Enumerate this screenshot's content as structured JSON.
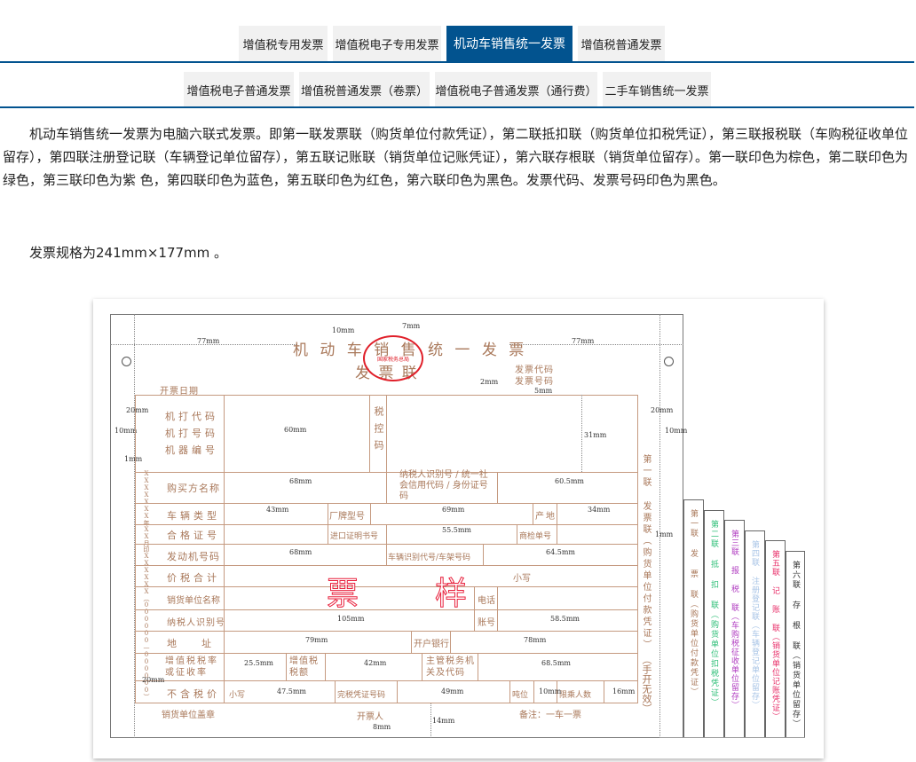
{
  "tabs_row1": [
    "增值税专用发票",
    "增值税电子专用发票",
    "机动车销售统一发票",
    "增值税普通发票"
  ],
  "tabs_row2": [
    "增值税电子普通发票",
    "增值税普通发票（卷票）",
    "增值税电子普通发票（通行费）",
    "二手车销售统一发票"
  ],
  "active_tab": "机动车销售统一发票",
  "description": "机动车销售统一发票为电脑六联式发票。即第一联发票联（购货单位付款凭证），第二联抵扣联（购货单位扣税凭证），第三联报税联（车购税征收单位留存），第四联注册登记联（车辆登记单位留存），第五联记账联（销货单位记账凭证），第六联存根联（销货单位留存）。第一联印色为棕色，第二联印色为绿色，第三联印色为紫 色，第四联印色为蓝色，第五联印色为红色，第六联印色为黑色。发票代码、发票号码印色为黑色。",
  "spec": "发票规格为241mm×177mm 。",
  "invoice": {
    "title": "机 动 车 销 售 统 一 发 票",
    "subtitle": "发 票 联",
    "seal": "国家税务总局",
    "date_label": "开票日期",
    "code_label": "发票代码",
    "number_label": "发票号码",
    "watermark": [
      "票",
      "样"
    ],
    "labels": {
      "machine_code": "机打代码",
      "machine_number": "机打号码",
      "machine_id": "机器编号",
      "tax_code": "税控码",
      "buyer": "购买方名称",
      "buyer_id": "纳税人识别号 / 统一社会信用代码 / 身份证号码",
      "vehicle_type": "车辆类型",
      "brand": "厂牌型号",
      "origin": "产地",
      "cert": "合格证号",
      "import_cert": "进口证明书号",
      "inspection": "商检单号",
      "engine": "发动机号码",
      "vin": "车辆识别代号/车架号码",
      "total": "价税合计",
      "lowercase": "小写",
      "seller": "销货单位名称",
      "phone": "电话",
      "seller_id": "纳税人识别号",
      "account": "账号",
      "address": "地　　址",
      "bank": "开户银行",
      "vat_rate": "增值税税率或征收率",
      "vat_amount": "增值税税额",
      "tax_office": "主管税务机关及代码",
      "net_price": "不含税价",
      "tax_cert": "完税凭证号码",
      "tonnage": "吨位",
      "seats": "限乘人数",
      "seal_label": "销货单位盖章",
      "issuer": "开票人",
      "remark": "备注：一车一票",
      "side_note": "第一联 发票联（购货单位付款凭证）",
      "void_note": "（手开无效）",
      "left_edge": "XXXXXXX年XX月印XXXXXX（000000—000000）"
    },
    "dims": {
      "top_left": "77mm",
      "top_right": "77mm",
      "t10": "10mm",
      "t7": "7mm",
      "t2": "2mm",
      "t5": "5mm",
      "l20": "20mm",
      "l10": "10mm",
      "l1": "1mm",
      "r20": "20mm",
      "r10": "10mm",
      "r1": "1mm",
      "d60": "60mm",
      "d31": "31mm",
      "d68a": "68mm",
      "d605": "60.5mm",
      "d43": "43mm",
      "d69": "69mm",
      "d34": "34mm",
      "d555": "55.5mm",
      "d68b": "68mm",
      "d645": "64.5mm",
      "d105": "105mm",
      "d585": "58.5mm",
      "d79": "79mm",
      "d78": "78mm",
      "d255": "25.5mm",
      "d42": "42mm",
      "d685": "68.5mm",
      "d475": "47.5mm",
      "d49": "49mm",
      "d10": "10mm",
      "d16": "16mm",
      "b20": "20mm",
      "b14": "14mm",
      "b8": "8mm"
    },
    "copies": [
      {
        "label": "第一联 发 票 联（购货单位付款凭证）",
        "color": "#a9785a"
      },
      {
        "label": "第二联 抵 扣 联（购货单位扣税凭证）",
        "color": "#2fbf78"
      },
      {
        "label": "第三联 报 税 联（车购税征收单位留存）",
        "color": "#b03cc0"
      },
      {
        "label": "第四联 注册登记联（车辆登记单位留存）",
        "color": "#a8c4e6"
      },
      {
        "label": "第五联 记 账 联（销货单位记账凭证）",
        "color": "#e8306a"
      },
      {
        "label": "第六联 存 根 联（销货单位留存）",
        "color": "#333333"
      }
    ]
  }
}
